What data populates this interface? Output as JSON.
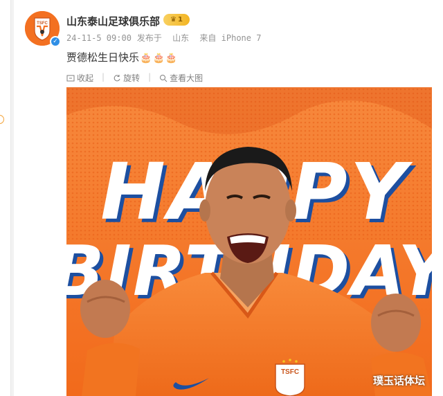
{
  "post": {
    "author": "山东泰山足球俱乐部",
    "badge_level": "1",
    "date": "24-11-5 09:00",
    "published_label": "发布于",
    "location": "山东",
    "source": "来自 iPhone 7",
    "text": "贾德松生日快乐",
    "emojis": [
      "🎂",
      "🎂",
      "🎂"
    ]
  },
  "avatar": {
    "club_abbr": "TSFC"
  },
  "tools": {
    "collapse": "收起",
    "rotate": "旋转",
    "view_large": "查看大图"
  },
  "image": {
    "headline_line1": "HAPPY",
    "headline_line2": "BIRTHDAY",
    "crest_text": "TSFC",
    "watermark": "璞玉话体坛"
  },
  "colors": {
    "brand_orange": "#f37021",
    "deep_orange": "#d9531a",
    "verified_blue": "#2f8fe6",
    "text_main": "#333333",
    "text_meta": "#939393"
  }
}
